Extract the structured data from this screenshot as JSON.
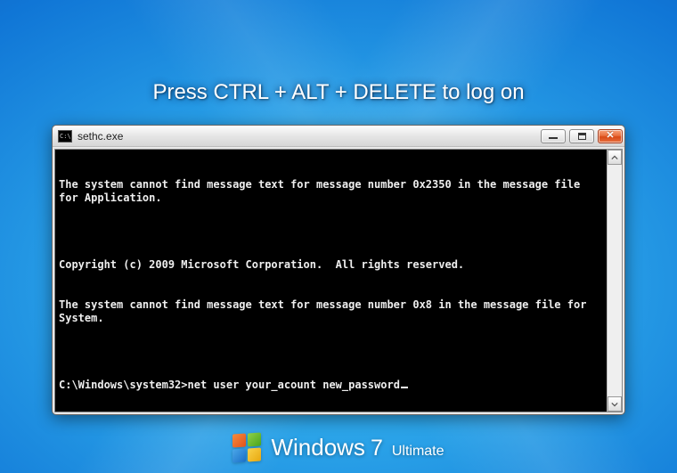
{
  "logon_instruction": "Press CTRL + ALT + DELETE to log on",
  "window": {
    "title": "sethc.exe",
    "lines": [
      "The system cannot find message text for message number 0x2350 in the message file for Application.",
      "",
      "Copyright (c) 2009 Microsoft Corporation.  All rights reserved.",
      "The system cannot find message text for message number 0x8 in the message file for System.",
      ""
    ],
    "prompt_prefix": "C:\\Windows\\system32>",
    "prompt_input": "net user your_acount new_password",
    "controls": {
      "minimize": "minimize",
      "maximize": "maximize",
      "close": "✕"
    }
  },
  "branding": {
    "product": "Windows",
    "version": "7",
    "edition": "Ultimate"
  }
}
